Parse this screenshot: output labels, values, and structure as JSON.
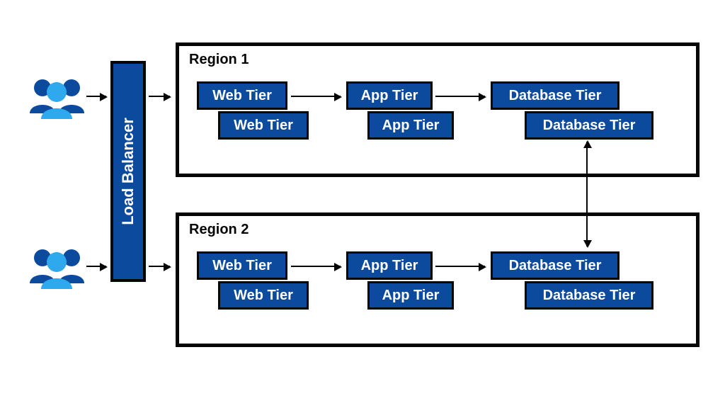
{
  "load_balancer": {
    "label": "Load Balancer"
  },
  "regions": [
    {
      "title": "Region 1",
      "tiers": {
        "web": [
          "Web Tier",
          "Web Tier"
        ],
        "app": [
          "App Tier",
          "App Tier"
        ],
        "db": [
          "Database Tier",
          "Database Tier"
        ]
      }
    },
    {
      "title": "Region 2",
      "tiers": {
        "web": [
          "Web Tier",
          "Web Tier"
        ],
        "app": [
          "App Tier",
          "App Tier"
        ],
        "db": [
          "Database Tier",
          "Database Tier"
        ]
      }
    }
  ],
  "colors": {
    "accent": "#0b4a9d",
    "border": "#060505",
    "user_light": "#2ea9ee",
    "user_dark": "#0b4a9d"
  }
}
